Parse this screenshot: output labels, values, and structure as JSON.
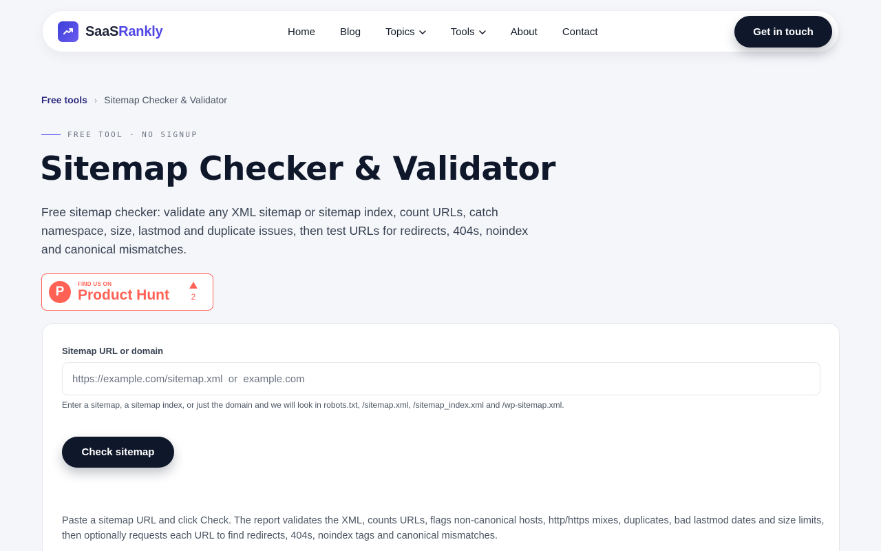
{
  "brand": {
    "part1": "SaaS",
    "part2": "Rankly",
    "logo_icon": "trending-up-icon",
    "accent": "#4f46e5"
  },
  "nav": {
    "items": [
      {
        "label": "Home",
        "dropdown": false
      },
      {
        "label": "Blog",
        "dropdown": false
      },
      {
        "label": "Topics",
        "dropdown": true
      },
      {
        "label": "Tools",
        "dropdown": true
      },
      {
        "label": "About",
        "dropdown": false
      },
      {
        "label": "Contact",
        "dropdown": false
      }
    ],
    "cta_label": "Get in touch"
  },
  "breadcrumb": {
    "parent": "Free tools",
    "separator": "›",
    "current": "Sitemap Checker & Validator"
  },
  "eyebrow": "FREE TOOL · NO SIGNUP",
  "title": "Sitemap Checker & Validator",
  "lede": "Free sitemap checker: validate any XML sitemap or sitemap index, count URLs, catch namespace, size, lastmod and duplicate issues, then test URLs for redirects, 404s, noindex and canonical mismatches.",
  "product_hunt": {
    "small": "FIND US ON",
    "big": "Product Hunt",
    "letter": "P",
    "votes": "2",
    "color": "#ff6154"
  },
  "form": {
    "label": "Sitemap URL or domain",
    "placeholder": "https://example.com/sitemap.xml  or  example.com",
    "value": "",
    "hint": "Enter a sitemap, a sitemap index, or just the domain and we will look in robots.txt, /sitemap.xml, /sitemap_index.xml and /wp-sitemap.xml.",
    "button": "Check sitemap"
  },
  "help_text": "Paste a sitemap URL and click Check. The report validates the XML, counts URLs, flags non-canonical hosts, http/https mixes, duplicates, bad lastmod dates and size limits, then optionally requests each URL to find redirects, 404s, noindex tags and canonical mismatches."
}
